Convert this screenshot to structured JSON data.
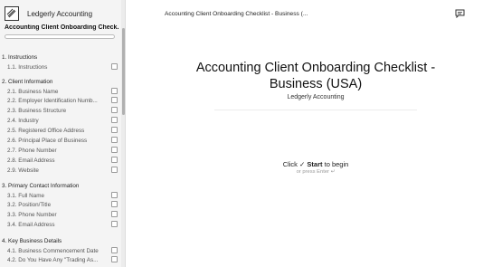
{
  "sidebar": {
    "brand_name": "Ledgerly Accounting",
    "doc_title": "Accounting Client Onboarding Check...",
    "progress_fraction": 0.0,
    "sections": [
      {
        "title": "1. Instructions",
        "items": [
          "1.1. Instructions"
        ]
      },
      {
        "title": "2. Client Information",
        "items": [
          "2.1. Business Name",
          "2.2. Employer Identification Numb...",
          "2.3. Business Structure",
          "2.4. Industry",
          "2.5. Registered Office Address",
          "2.6. Principal Place of Business",
          "2.7. Phone Number",
          "2.8. Email Address",
          "2.9. Website"
        ]
      },
      {
        "title": "3. Primary Contact Information",
        "items": [
          "3.1. Full Name",
          "3.2. Position/Title",
          "3.3. Phone Number",
          "3.4. Email Address"
        ]
      },
      {
        "title": "4. Key Business Details",
        "items": [
          "4.1. Business Commencement Date",
          "4.2. Do You Have Any \"Trading As..."
        ]
      }
    ]
  },
  "topbar": {
    "title": "Accounting Client Onboarding Checklist - Business (...",
    "chat_icon": "chat-icon"
  },
  "main": {
    "title": "Accounting Client Onboarding Checklist - Business (USA)",
    "subtitle": "Ledgerly Accounting",
    "start_prefix": "Click",
    "start_check": "✓",
    "start_label": "Start",
    "start_suffix": "to begin",
    "hint": "or press Enter ↵"
  }
}
